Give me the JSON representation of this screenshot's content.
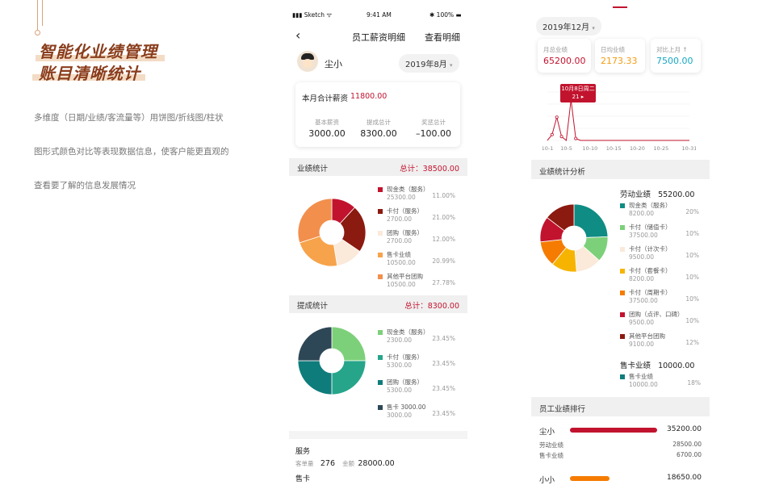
{
  "intro": {
    "title1": "智能化业绩管理",
    "title2": "账目清晰统计",
    "lines": [
      "多维度（日期/业绩/客流量等）用饼图/折线图/柱状",
      "图形式颜色对比等表现数据信息，使客户能更直观的",
      "查看要了解的信息发展情况"
    ]
  },
  "mid": {
    "status": {
      "carrier": "Sketch",
      "time": "9:41 AM",
      "battery": "100%"
    },
    "nav": {
      "title": "员工薪资明细",
      "right": "查看明细"
    },
    "user": {
      "name": "尘小",
      "month": "2019年8月"
    },
    "salary": {
      "label": "本月合计薪资",
      "total": "11800.00",
      "items": [
        {
          "label": "基本薪资",
          "value": "3000.00"
        },
        {
          "label": "提成总计",
          "value": "8300.00"
        },
        {
          "label": "奖惩总计",
          "value": "–100.00"
        }
      ]
    },
    "perf": {
      "title": "业绩统计",
      "total": "总计：38500.00",
      "legend": [
        {
          "name": "现金类（服务）",
          "value": "25300.00",
          "pct": "11.00%",
          "color": "#c2132e"
        },
        {
          "name": "卡付（服务）",
          "value": "2700.00",
          "pct": "21.00%",
          "color": "#8b1a10"
        },
        {
          "name": "团购（服务）",
          "value": "2700.00",
          "pct": "12.00%",
          "color": "#fbe9d9"
        },
        {
          "name": "售卡业绩",
          "value": "10500.00",
          "pct": "20.99%",
          "color": "#f7a34b"
        },
        {
          "name": "其他平台团购",
          "value": "10500.00",
          "pct": "27.78%",
          "color": "#f28f4c"
        }
      ]
    },
    "comm": {
      "title": "提成统计",
      "total": "总计：8300.00",
      "legend": [
        {
          "name": "现金类（服务）",
          "value": "2300.00",
          "pct": "23.45%",
          "color": "#7dd07a"
        },
        {
          "name": "卡付（服务）",
          "value": "5300.00",
          "pct": "23.45%",
          "color": "#26a58b"
        },
        {
          "name": "团购（服务）",
          "value": "5300.00",
          "pct": "23.45%",
          "color": "#0f7c7c"
        },
        {
          "name": "售卡  3000.00",
          "value": "3000.00",
          "pct": "23.45%",
          "color": "#2e4756"
        }
      ]
    },
    "footer": {
      "service": "服务",
      "k1": "客单量",
      "v1": "276",
      "k2": "金额",
      "v2": "28000.00",
      "card": "售卡"
    }
  },
  "right": {
    "month": "2019年12月",
    "kpis": [
      {
        "label": "月总业绩",
        "value": "65200.00",
        "color": "#c2132e"
      },
      {
        "label": "日均业绩",
        "value": "2173.33",
        "color": "#f39c12"
      },
      {
        "label": "对比上月 ↑",
        "value": "7500.00",
        "color": "#17a8c4"
      }
    ],
    "tooltip": {
      "line1": "10月8日周二",
      "line2": "21 ▸"
    },
    "chart_data": {
      "type": "line",
      "x": [
        "10-1",
        "10-5",
        "10-10",
        "10-15",
        "10-20",
        "10-25",
        "10-31"
      ],
      "series": [
        {
          "values": [
            0,
            3,
            12,
            2,
            0,
            21,
            1,
            0,
            0,
            0,
            0,
            0,
            0,
            0,
            0,
            0,
            0,
            0,
            0,
            0,
            0,
            0,
            0,
            0,
            0,
            0,
            0,
            0,
            0,
            0,
            0
          ]
        }
      ],
      "ylim": [
        0,
        25
      ]
    },
    "analysis": {
      "title": "业绩统计分析",
      "labor": {
        "label": "劳动业绩",
        "value": "55200.00"
      },
      "legend": [
        {
          "name": "现金类（服务）",
          "value": "8200.00",
          "pct": "20%",
          "color": "#0f8c84"
        },
        {
          "name": "卡付（储值卡）",
          "value": "37500.00",
          "pct": "10%",
          "color": "#7dd07a"
        },
        {
          "name": "卡付（计次卡）",
          "value": "9500.00",
          "pct": "10%",
          "color": "#fbe9d9"
        },
        {
          "name": "卡付（套餐卡）",
          "value": "8200.00",
          "pct": "10%",
          "color": "#f6b400"
        },
        {
          "name": "卡付（周期卡）",
          "value": "37500.00",
          "pct": "10%",
          "color": "#f57c00"
        },
        {
          "name": "团购（点评、口碑）",
          "value": "9500.00",
          "pct": "10%",
          "color": "#c2132e"
        },
        {
          "name": "其他平台团购",
          "value": "9100.00",
          "pct": "12%",
          "color": "#8b1a10"
        }
      ],
      "card": {
        "label": "售卡业绩",
        "value": "10000.00"
      },
      "card_legend": {
        "name": "售卡业绩",
        "value": "10000.00",
        "pct": "18%",
        "color": "#0f7c7c"
      }
    },
    "rank": {
      "title": "员工业绩排行",
      "rows": [
        {
          "name": "尘小",
          "total": "35200.00",
          "fill": 1.0,
          "color": "#c2132e",
          "subs": [
            {
              "label": "劳动业绩",
              "value": "28500.00"
            },
            {
              "label": "售卡业绩",
              "value": "6700.00"
            }
          ]
        },
        {
          "name": "小小",
          "total": "18650.00",
          "fill": 0.45,
          "color": "#f57c00",
          "subs": []
        }
      ]
    }
  }
}
